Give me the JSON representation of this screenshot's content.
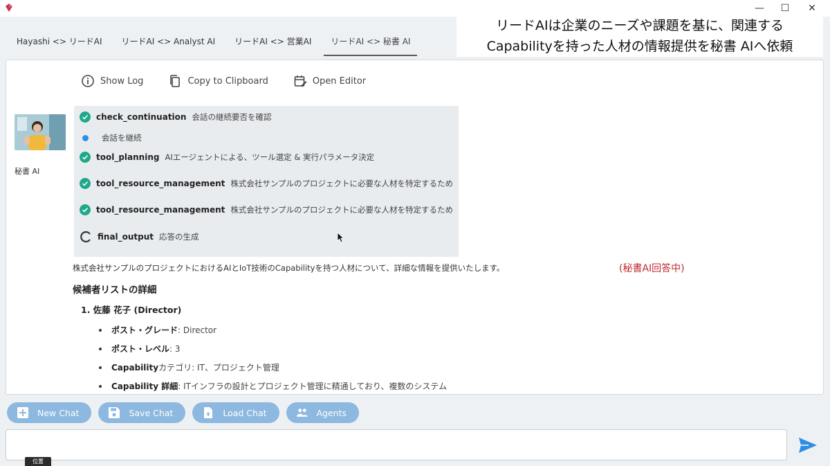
{
  "window": {
    "minimize": "—",
    "maximize": "☐",
    "close": "✕"
  },
  "caption": {
    "line1": "リードAIは企業のニーズや課題を基に、関連する",
    "line2": "Capabilityを持った人材の情報提供を秘書 AIへ依頼"
  },
  "tabs": [
    {
      "label": "Hayashi <> リードAI"
    },
    {
      "label": "リードAI <> Analyst AI"
    },
    {
      "label": "リードAI <> 営業AI"
    },
    {
      "label": "リードAI <> 秘書 AI"
    }
  ],
  "toolbar": {
    "show_log": "Show Log",
    "copy": "Copy to Clipboard",
    "open_editor": "Open Editor"
  },
  "agent": {
    "name": "秘書 AI"
  },
  "steps": [
    {
      "name": "check_continuation",
      "desc": "会話の継続要否を確認",
      "status": "done"
    },
    {
      "name": "",
      "desc": "会話を継続",
      "status": "info"
    },
    {
      "name": "tool_planning",
      "desc": "AIエージェントによる、ツール選定 & 実行パラメータ決定",
      "status": "done"
    },
    {
      "name": "tool_resource_management",
      "desc": "株式会社サンプルのプロジェクトに必要な人材を特定するため",
      "status": "done"
    },
    {
      "name": "tool_resource_management",
      "desc": "株式会社サンプルのプロジェクトに必要な人材を特定するため",
      "status": "done"
    },
    {
      "name": "final_output",
      "desc": "応答の生成",
      "status": "running"
    }
  ],
  "response": {
    "intro": "株式会社サンプルのプロジェクトにおけるAIとIoT技術のCapabilityを持つ人材について、詳細な情報を提供いたします。",
    "status": "(秘書AI回答中)",
    "heading": "候補者リストの詳細",
    "candidate": "1. 佐藤 花子 (Director)",
    "details": [
      {
        "key": "ポスト・グレード",
        "value": ": Director"
      },
      {
        "key": "ポスト・レベル",
        "value": ": 3"
      },
      {
        "key": "Capability",
        "value": " カテゴリ: IT、プロジェクト管理"
      },
      {
        "key": "Capability 詳細",
        "value": ": ITインフラの設計とプロジェクト管理に精通しており、複数のシステム"
      }
    ]
  },
  "buttons": {
    "new_chat": "New Chat",
    "save_chat": "Save Chat",
    "load_chat": "Load Chat",
    "agents": "Agents"
  },
  "input": {
    "value": "",
    "placeholder": ""
  },
  "tooltip": {
    "text": "位置"
  },
  "colors": {
    "accent_button": "#8db8df",
    "check_green": "#1fa88a",
    "info_blue": "#2f8de4",
    "status_red": "#c0272d",
    "send_blue": "#2f8de4"
  }
}
